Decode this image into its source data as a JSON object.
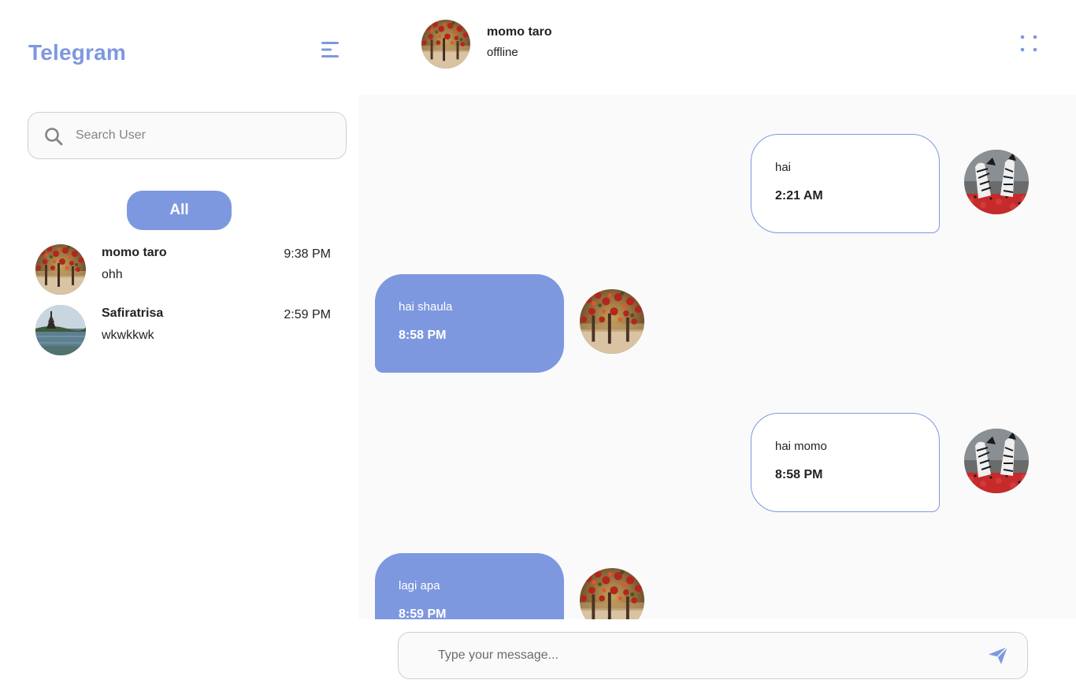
{
  "app": {
    "brand": "Telegram",
    "accent_color": "#7e98df"
  },
  "sidebar": {
    "menu_icon": "hamburger-menu-icon",
    "search": {
      "placeholder": "Search User",
      "value": "",
      "icon": "search-icon"
    },
    "filter": {
      "label": "All"
    },
    "contacts": [
      {
        "name": "momo taro",
        "preview": "ohh",
        "time": "9:38 PM",
        "avatar": "red-flowers-photo"
      },
      {
        "name": "Safiratrisa",
        "preview": "wkwkkwk",
        "time": "2:59 PM",
        "avatar": "lake-temple-photo"
      }
    ]
  },
  "chat": {
    "header": {
      "name": "momo taro",
      "status": "offline",
      "menu_icon": "dots-grid-icon"
    },
    "messages": [
      {
        "direction": "out",
        "text": "hai",
        "time": "2:21 AM"
      },
      {
        "direction": "in",
        "text": "hai shaula",
        "time": "8:58 PM"
      },
      {
        "direction": "out",
        "text": "hai momo",
        "time": "8:58 PM"
      },
      {
        "direction": "in",
        "text": "lagi apa",
        "time": "8:59 PM"
      }
    ],
    "composer": {
      "placeholder": "Type your message...",
      "value": "",
      "send_icon": "send-icon"
    }
  }
}
